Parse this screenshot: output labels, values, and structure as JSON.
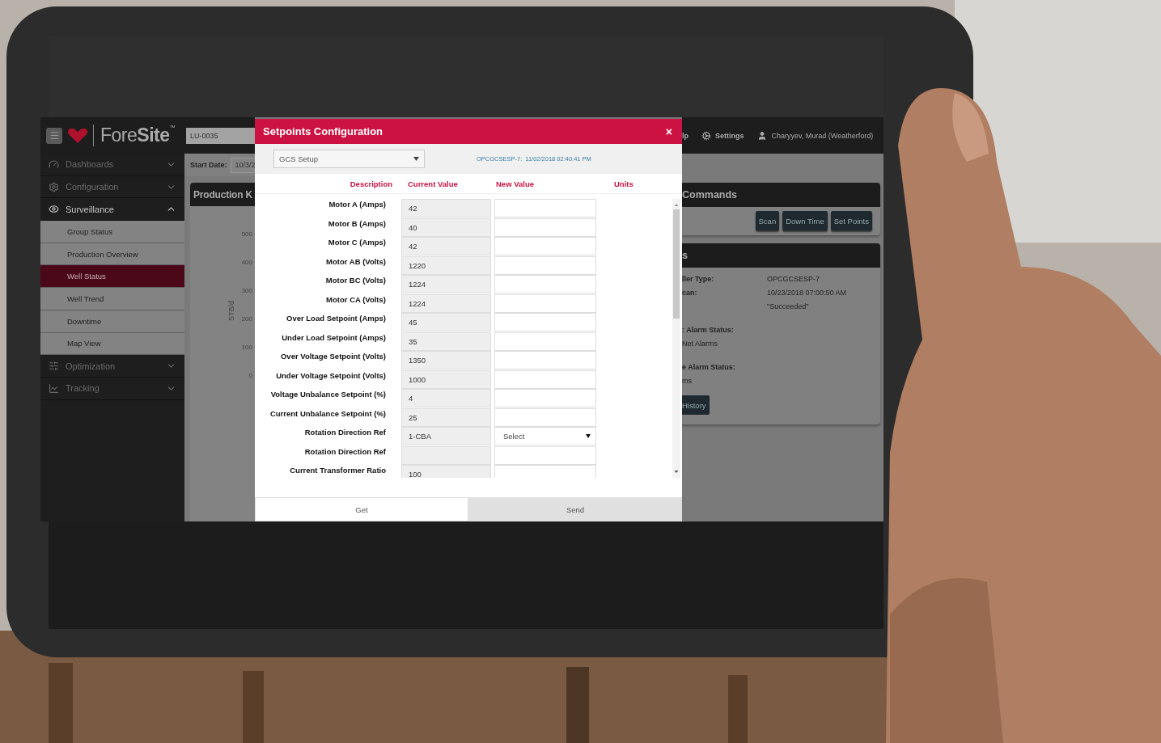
{
  "app": {
    "logo": "Fore**Site**$^{™}$",
    "well_field": "LU-0035",
    "header_links": [
      {
        "label": "lp",
        "kind": "text"
      },
      {
        "label": "Settings",
        "kind": "settings"
      }
    ],
    "user": "Charyyev, Murad (Weatherford)",
    "nav": [
      {
        "label": "Dashboards",
        "expanded": false
      },
      {
        "label": "Configuration",
        "expanded": false
      },
      {
        "label": "Surveillance",
        "expanded": true,
        "children": [
          {
            "label": "Group Status",
            "selected": false
          },
          {
            "label": "Production Overview",
            "selected": false
          },
          {
            "label": "Well Status",
            "selected": true
          },
          {
            "label": "Well Trend",
            "selected": false
          },
          {
            "label": "Downtime",
            "selected": false
          },
          {
            "label": "Map View",
            "selected": false
          }
        ]
      },
      {
        "label": "Optimization",
        "expanded": false
      },
      {
        "label": "Tracking",
        "expanded": false
      }
    ],
    "date_filter": {
      "label": "Start Date:",
      "value": "10/3/2"
    },
    "production_panel": {
      "title": "Production K",
      "axis_title": "STB/d",
      "y_ticks": [
        "500",
        "400",
        "300",
        "200",
        "100",
        "0"
      ]
    },
    "commands_panel": {
      "title": "Commands",
      "buttons": [
        "Scan",
        "Down Time",
        "Set Points"
      ]
    },
    "status_panel": {
      "title": "s",
      "items": [
        {
          "kind": "pair",
          "label": "ller Type:",
          "value": "OPCGCSESP-7"
        },
        {
          "kind": "pair",
          "label": "can:",
          "value": "10/23/2018 07:00:50 AM"
        },
        {
          "kind": "value",
          "value": "\"Succeeded\""
        },
        {
          "kind": "heading",
          "label": ": Alarm Status:"
        },
        {
          "kind": "text",
          "label": "Net Alarms"
        },
        {
          "kind": "heading",
          "label": "e Alarm Status:"
        },
        {
          "kind": "text",
          "label": "ms"
        },
        {
          "kind": "button",
          "label": "History"
        }
      ]
    }
  },
  "dialog": {
    "title": "Setpoints Configuration",
    "close": "×",
    "setup": "GCS Setup",
    "controller": "OPCGCSESP-7:",
    "timestamp": "11/02/2018 02:40:41 PM",
    "columns": [
      "Description",
      "Current Value",
      "New Value",
      "Units"
    ],
    "rows": [
      {
        "description": "Motor A (Amps)",
        "current": "42",
        "kind": "input"
      },
      {
        "description": "Motor B (Amps)",
        "current": "40",
        "kind": "input"
      },
      {
        "description": "Motor C (Amps)",
        "current": "42",
        "kind": "input"
      },
      {
        "description": "Motor AB (Volts)",
        "current": "1220",
        "kind": "input"
      },
      {
        "description": "Motor BC (Volts)",
        "current": "1224",
        "kind": "input"
      },
      {
        "description": "Motor CA (Volts)",
        "current": "1224",
        "kind": "input"
      },
      {
        "description": "Over Load Setpoint (Amps)",
        "current": "45",
        "kind": "input"
      },
      {
        "description": "Under Load Setpoint (Amps)",
        "current": "35",
        "kind": "input"
      },
      {
        "description": "Over Voltage Setpoint (Volts)",
        "current": "1350",
        "kind": "input"
      },
      {
        "description": "Under Voltage Setpoint (Volts)",
        "current": "1000",
        "kind": "input"
      },
      {
        "description": "Voltage Unbalance Setpoint (%)",
        "current": "4",
        "kind": "input"
      },
      {
        "description": "Current Unbalance Setpoint (%)",
        "current": "25",
        "kind": "input"
      },
      {
        "description": "Rotation Direction Ref",
        "current": "1-CBA",
        "kind": "select",
        "new_value": "Select"
      },
      {
        "description": "Rotation Direction Ref",
        "kind": "input"
      },
      {
        "description": "Current Transformer Ratio",
        "current": "100",
        "kind": "input"
      }
    ],
    "buttons": [
      {
        "label": "Get",
        "selected": true
      },
      {
        "label": "Send",
        "selected": false
      }
    ]
  }
}
